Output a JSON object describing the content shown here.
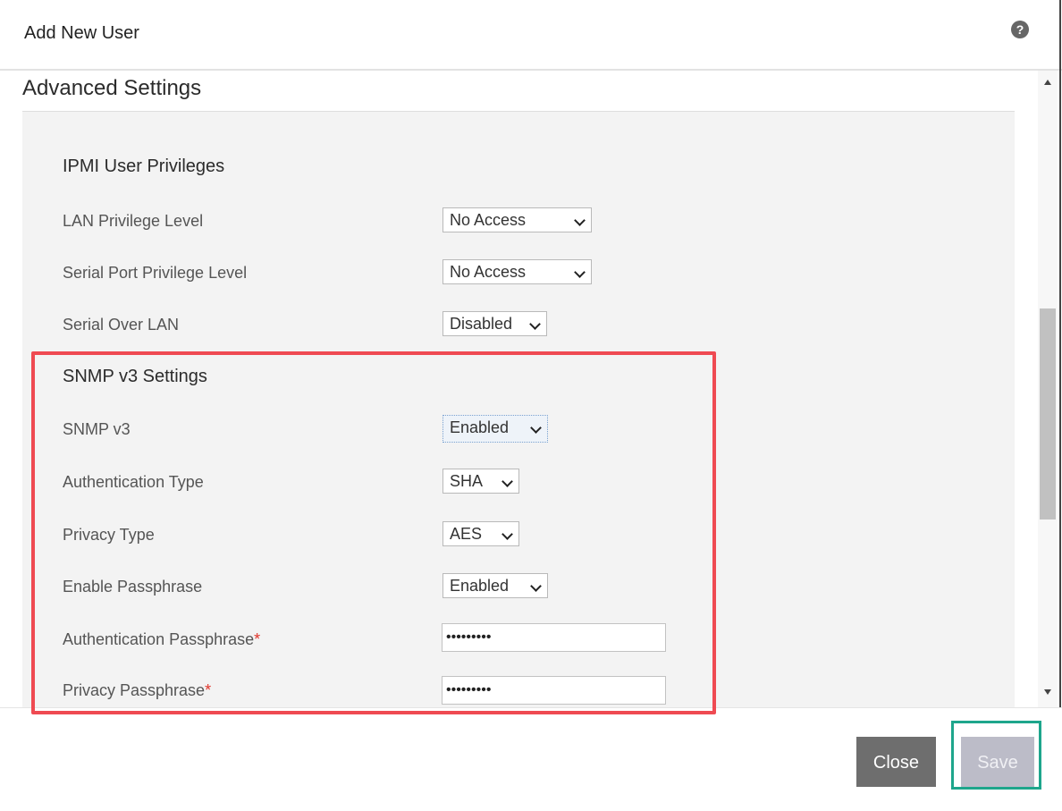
{
  "dialog": {
    "title": "Add New User",
    "help_icon_glyph": "?",
    "help_icon": "question-circle-icon"
  },
  "advanced": {
    "title": "Advanced Settings"
  },
  "ipmi": {
    "title": "IPMI User Privileges",
    "lan_label": "LAN Privilege Level",
    "lan_value": "No Access",
    "serial_port_label": "Serial Port Privilege Level",
    "serial_port_value": "No Access",
    "sol_label": "Serial Over LAN",
    "sol_value": "Disabled"
  },
  "snmp": {
    "title": "SNMP v3 Settings",
    "snmp_label": "SNMP v3",
    "snmp_value": "Enabled",
    "auth_type_label": "Authentication Type",
    "auth_type_value": "SHA",
    "privacy_type_label": "Privacy Type",
    "privacy_type_value": "AES",
    "enable_passphrase_label": "Enable Passphrase",
    "enable_passphrase_value": "Enabled",
    "auth_passphrase_label": "Authentication Passphrase",
    "auth_passphrase_value": "•••••••••",
    "privacy_passphrase_label": "Privacy Passphrase",
    "privacy_passphrase_value": "•••••••••",
    "required_mark": "*"
  },
  "footer": {
    "close_label": "Close",
    "save_label": "Save"
  },
  "colors": {
    "highlight_red": "#ef4a52",
    "highlight_green": "#1ea68c",
    "close_button": "#6e6e6e",
    "save_button_disabled": "#bcbcc8"
  }
}
